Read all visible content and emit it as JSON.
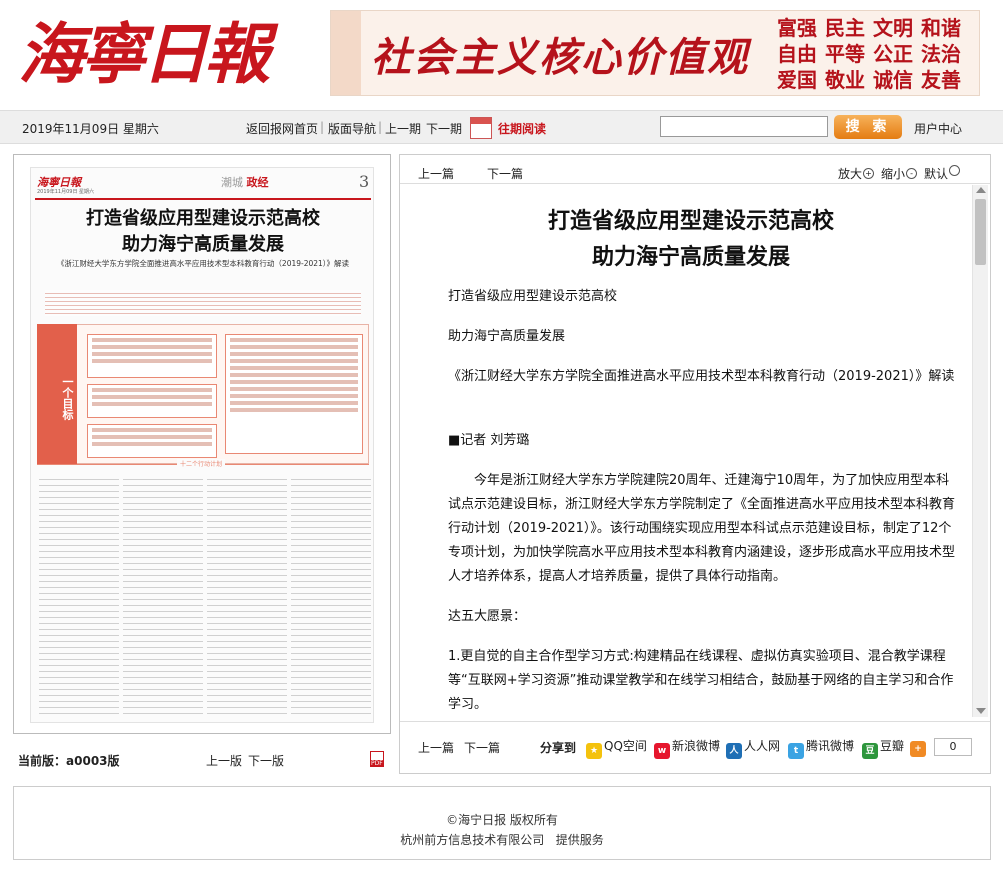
{
  "header": {
    "logo_text": "海寧日報",
    "banner_slogan": "社会主义核心价值观",
    "core_values": [
      "富强",
      "民主",
      "文明",
      "和谐",
      "自由",
      "平等",
      "公正",
      "法治",
      "爱国",
      "敬业",
      "诚信",
      "友善"
    ]
  },
  "navbar": {
    "date": "2019年11月09日 星期六",
    "home": "返回报网首页",
    "layout_nav": "版面导航",
    "prev_issue": "上一期",
    "next_issue": "下一期",
    "archive": "往期阅读",
    "search_value": "",
    "search_button": "搜 索",
    "user_center": "用户中心"
  },
  "thumbnail": {
    "masthead": "海寧日報",
    "masthead_sub": "2019年11月09日 星期六",
    "section_city": "潮城",
    "section": "政经",
    "page_number": "3",
    "headline_1": "打造省级应用型建设示范高校",
    "headline_2": "助力海宁高质量发展",
    "subtitle": "《浙江财经大学东方学院全面推进高水平应用技术型本科教育行动（2019-2021）》解读",
    "tag": "一个目标",
    "section_marker": "十二个行动计划"
  },
  "left_footer": {
    "current_page_label": "当前版：",
    "current_page": "a0003版",
    "prev_page": "上一版",
    "next_page": "下一版"
  },
  "article_nav": {
    "prev": "上一篇",
    "next": "下一篇",
    "zoom_in": "放大",
    "zoom_out": "缩小",
    "zoom_default": "默认"
  },
  "article": {
    "title_1": "打造省级应用型建设示范高校",
    "title_2": "助力海宁高质量发展",
    "paragraphs": [
      "打造省级应用型建设示范高校",
      "助力海宁高质量发展",
      "《浙江财经大学东方学院全面推进高水平应用技术型本科教育行动（2019-2021）》解读",
      "■记者 刘芳璐",
      "今年是浙江财经大学东方学院建院20周年、迁建海宁10周年，为了加快应用型本科试点示范建设目标，浙江财经大学东方学院制定了《全面推进高水平应用技术型本科教育行动计划（2019-2021）》。该行动围绕实现应用型本科试点示范建设目标，制定了12个专项计划，为加快学院高水平应用技术型本科教育内涵建设，逐步形成高水平应用技术型人才培养体系，提高人才培养质量，提供了具体行动指南。",
      "达五大愿景：",
      "1.更自觉的自主合作型学习方式:构建精品在线课程、虚拟仿真实验项目、混合教学课程等“互联网+学习资源”推动课堂教学和在线学习相结合，鼓励基于网络的自主学习和合作学习。"
    ]
  },
  "share": {
    "label": "分享到",
    "items": [
      "QQ空间",
      "新浪微博",
      "人人网",
      "腾讯微博",
      "豆瓣"
    ],
    "count": "0"
  },
  "footer": {
    "copyright": "©海宁日报 版权所有",
    "provider": "杭州前方信息技术有限公司   提供服务"
  },
  "colors": {
    "brand_red": "#c8161d",
    "search_orange": "#e47c12"
  }
}
